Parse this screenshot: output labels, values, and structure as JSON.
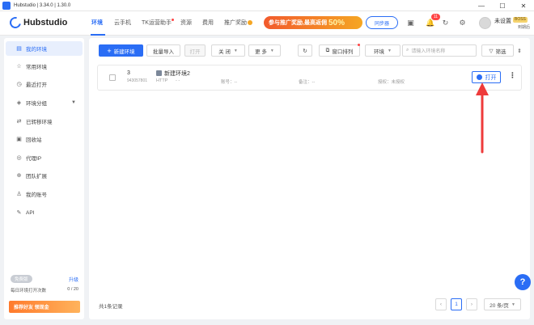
{
  "window": {
    "title": "Hubstudio | 3.34.0 | 1.30.0",
    "controls": [
      "—",
      "☐",
      "✕"
    ]
  },
  "nav": {
    "logo": "Hubstudio",
    "items": [
      "环境",
      "云手机",
      "TK运营助手",
      "资源",
      "费用",
      "推广奖励"
    ],
    "promo_text": "参与推广奖励,最高返佣",
    "promo_pct": "50%",
    "sync_label": "同步器",
    "notification_count": "11",
    "username": "未设置",
    "badge": "BOSS",
    "expire": "到期后"
  },
  "sidebar": {
    "items": [
      {
        "label": "我的环境",
        "icon": "▤"
      },
      {
        "label": "常用环境",
        "icon": "☆"
      },
      {
        "label": "最近打开",
        "icon": "◷"
      },
      {
        "label": "环境分组",
        "icon": "◈"
      },
      {
        "label": "已转移环境",
        "icon": "⇄"
      },
      {
        "label": "回收站",
        "icon": "▣"
      },
      {
        "label": "代理IP",
        "icon": "◎"
      },
      {
        "label": "团队扩展",
        "icon": "⊕"
      },
      {
        "label": "我的账号",
        "icon": "♙"
      },
      {
        "label": "API",
        "icon": "✎"
      }
    ],
    "plan_tag": "免费版",
    "upgrade": "升级",
    "plan_label": "每日环境打开次数",
    "plan_count": "0 / 20",
    "invite": "推荐好友 领现金"
  },
  "toolbar": {
    "new_env": "新建环境",
    "batch_import": "批量导入",
    "open": "打开",
    "close": "关 闭",
    "more": "更 多",
    "window_arrange": "窗口排列",
    "env_filter": "环境",
    "search_placeholder": "请输入环境名称",
    "filter": "筛选"
  },
  "table": {
    "rows": [
      {
        "num": "3",
        "id": "943057801",
        "name": "新建环境2",
        "protocol": "HTTP",
        "proxy": "- -",
        "account": "账号：--",
        "remark": "备注：--",
        "auth": "授权：未授权",
        "open_label": "打开"
      }
    ]
  },
  "footer": {
    "total": "共1条记录",
    "page": "1",
    "page_size": "20 条/页"
  },
  "help": "?",
  "colors": {
    "accent": "#2a6df5",
    "annotation_arrow": "#ee3b3b"
  }
}
